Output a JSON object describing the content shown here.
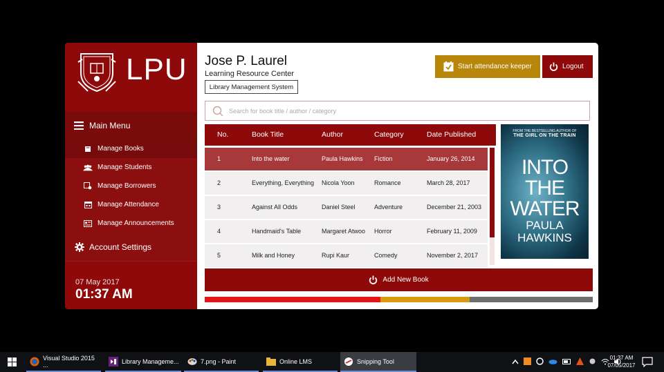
{
  "brand": {
    "name": "LPU",
    "crest_text": "VIRTUS IN SCIENTIA"
  },
  "sidebar": {
    "menu_title": "Main Menu",
    "items": [
      {
        "label": "Manage Books",
        "icon": "book-icon",
        "active": true
      },
      {
        "label": "Manage Students",
        "icon": "people-icon",
        "active": false
      },
      {
        "label": "Manage Borrowers",
        "icon": "borrower-icon",
        "active": false
      },
      {
        "label": "Manage Attendance",
        "icon": "calendar-icon",
        "active": false
      },
      {
        "label": "Manage Announcements",
        "icon": "announcement-icon",
        "active": false
      }
    ],
    "account_label": "Account Settings",
    "date": "07 May 2017",
    "time": "01:37 AM"
  },
  "header": {
    "org_name": "Jose P. Laurel",
    "org_sub": "Learning Resource Center",
    "system_name": "Library Management System",
    "attendance_label": "Start attendance keeper",
    "logout_label": "Logout"
  },
  "search": {
    "placeholder": "Search for book title / author / category"
  },
  "table": {
    "columns": [
      "No.",
      "Book Title",
      "Author",
      "Category",
      "Date Published"
    ],
    "rows": [
      {
        "no": "1",
        "title": "Into the water",
        "author": "Paula Hawkins",
        "category": "Fiction",
        "date": "January 26, 2014",
        "selected": true
      },
      {
        "no": "2",
        "title": "Everything, Everything",
        "author": "Nicola Yoon",
        "category": "Romance",
        "date": "March 28, 2017",
        "selected": false
      },
      {
        "no": "3",
        "title": "Against All Odds",
        "author": "Daniel Steel",
        "category": "Adventure",
        "date": "December 21, 2003",
        "selected": false
      },
      {
        "no": "4",
        "title": "Handmaid's Table",
        "author": "Margaret Atwoo",
        "category": "Horror",
        "date": "February 11, 2009",
        "selected": false
      },
      {
        "no": "5",
        "title": "Milk and Honey",
        "author": "Rupi Kaur",
        "category": "Comedy",
        "date": "November 2, 2017",
        "selected": false
      }
    ]
  },
  "cover": {
    "tag_line": "FROM THE BESTSELLING AUTHOR OF",
    "tag_title": "THE GIRL ON THE TRAIN",
    "title_line1": "INTO",
    "title_line2": "THE",
    "title_line3": "WATER",
    "author_line1": "PAULA",
    "author_line2": "HAWKINS"
  },
  "add_book_label": "Add New Book",
  "colors": {
    "primary": "#8e0a0a",
    "selected_row": "#a7393a",
    "gold": "#b8860b",
    "strip_red": "#e51515",
    "strip_gold": "#d89a0e",
    "strip_gray": "#6e6e6e"
  },
  "taskbar": {
    "items": [
      {
        "label": "Visual Studio 2015 ...",
        "icon": "firefox-icon"
      },
      {
        "label": "Library Manageme...",
        "icon": "visual-studio-icon"
      },
      {
        "label": "7.png - Paint",
        "icon": "paint-icon"
      },
      {
        "label": "Online LMS",
        "icon": "folder-icon"
      },
      {
        "label": "Snipping Tool",
        "icon": "snipping-tool-icon"
      }
    ],
    "clock_time": "01:37 AM",
    "clock_date": "07/05/2017"
  }
}
